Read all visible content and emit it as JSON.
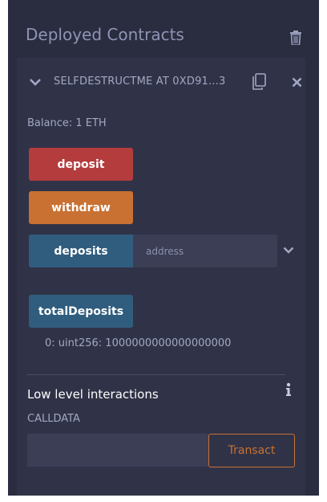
{
  "header": {
    "title": "Deployed Contracts",
    "trash_icon": "trash-icon"
  },
  "contract": {
    "name": "SELFDESTRUCTME AT 0XD91...3",
    "balance": "Balance: 1 ETH",
    "icons": [
      "chevron-down-icon",
      "copy-icon",
      "close-icon"
    ]
  },
  "functions": {
    "deposit_label": "deposit",
    "withdraw_label": "withdraw",
    "deposits_label": "deposits",
    "deposits_placeholder": "address",
    "total_label": "totalDeposits",
    "total_result": "0: uint256: 1000000000000000000"
  },
  "low_level": {
    "title": "Low level interactions",
    "calldata_label": "CALLDATA",
    "calldata_value": "",
    "transact_label": "Transact"
  },
  "colors": {
    "panel_bg": "#2a2c3f",
    "card_bg": "#303347",
    "deposit_btn": "#b43c3d",
    "withdraw_btn": "#c97132",
    "call_btn": "#305d7e",
    "transact_border": "#c97132"
  }
}
